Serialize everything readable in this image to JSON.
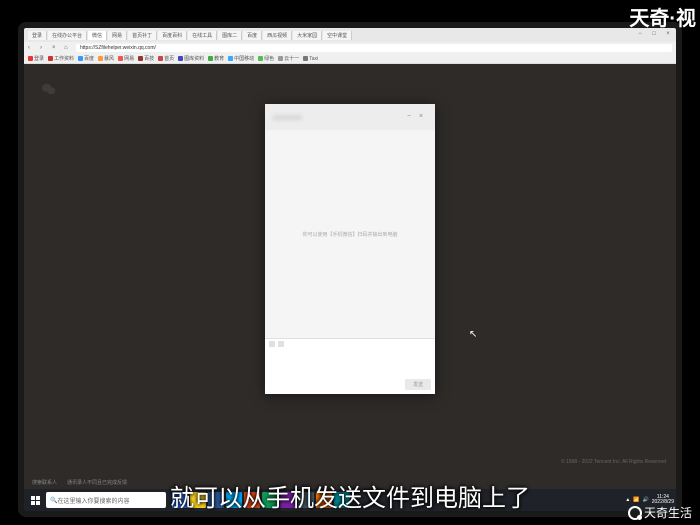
{
  "watermark": {
    "top": "天奇·视",
    "bottom": "天奇生活"
  },
  "subtitle": "就可以从手机发送文件到电脑上了",
  "browser": {
    "tabs": [
      "登录",
      "在线办公平台",
      "微信",
      "网易",
      "首页补丁",
      "百度百科",
      "在线工具",
      "图库二",
      "百度",
      "西瓜视频",
      "大米家园",
      "空中课堂"
    ],
    "url": "https://SZfilehelper.weixin.qq.com/",
    "bookmarks": [
      "登录",
      "工作资料",
      "百度",
      "暴风",
      "网易",
      "百技",
      "首页",
      "图库资料",
      "教育",
      "中国移动",
      "绿色",
      "云十一",
      "Taxi"
    ]
  },
  "dialog": {
    "title_blur": "■■■■■■",
    "hint": "你可以使用【手机微信】扫码并输出到电脑",
    "send": "发送"
  },
  "wechat_bar": {
    "search": "搜索联系人",
    "history": "通讯录人不同且已完成反馈"
  },
  "copyright": "© 1998 - 2022 Tencent Inc. All Rights Reserved",
  "taskbar": {
    "search_ph": "在这里输入你要搜索的内容",
    "time": "11:24",
    "date": "2022/8/29"
  }
}
